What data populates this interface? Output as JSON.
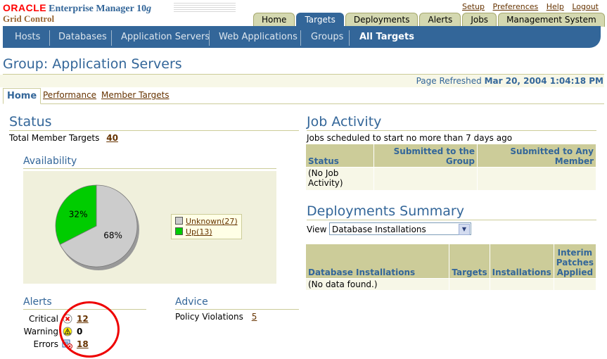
{
  "header": {
    "brand": "ORACLE",
    "product": "Enterprise Manager 10",
    "product_version_suffix": "g",
    "subproduct": "Grid Control",
    "global_links": [
      "Setup",
      "Preferences",
      "Help",
      "Logout"
    ]
  },
  "tabs": [
    {
      "label": "Home",
      "active": false
    },
    {
      "label": "Targets",
      "active": true
    },
    {
      "label": "Deployments",
      "active": false
    },
    {
      "label": "Alerts",
      "active": false
    },
    {
      "label": "Jobs",
      "active": false
    },
    {
      "label": "Management System",
      "active": false
    }
  ],
  "subnav": [
    {
      "label": "Hosts",
      "active": false
    },
    {
      "label": "Databases",
      "active": false
    },
    {
      "label": "Application Servers",
      "active": false
    },
    {
      "label": "Web Applications",
      "active": false
    },
    {
      "label": "Groups",
      "active": false
    },
    {
      "label": "All Targets",
      "active": true
    }
  ],
  "page": {
    "title": "Group: Application Servers",
    "refresh_label": "Page Refreshed",
    "refresh_time": "Mar 20, 2004 1:04:18 PM"
  },
  "subtabs": [
    "Home",
    "Performance",
    "Member Targets"
  ],
  "status": {
    "title": "Status",
    "total_label": "Total Member Targets",
    "total_value": "40",
    "availability_title": "Availability"
  },
  "chart_data": {
    "type": "pie",
    "slices": [
      {
        "label": "Unknown(27)",
        "value": 27,
        "percent_label": "68%",
        "color": "#cccccc"
      },
      {
        "label": "Up(13)",
        "value": 13,
        "percent_label": "32%",
        "color": "#00cc00"
      }
    ],
    "legend": "right"
  },
  "alerts": {
    "title": "Alerts",
    "rows": [
      {
        "label": "Critical",
        "icon": "critical-icon",
        "value": "12",
        "link": true
      },
      {
        "label": "Warning",
        "icon": "warning-icon",
        "value": "0",
        "link": false
      },
      {
        "label": "Errors",
        "icon": "errors-icon",
        "value": "18",
        "link": true
      }
    ]
  },
  "advice": {
    "title": "Advice",
    "label": "Policy Violations",
    "value": "5"
  },
  "job_activity": {
    "title": "Job Activity",
    "subtitle": "Jobs scheduled to start no more than 7 days ago",
    "columns": [
      "Status",
      "Submitted to the Group",
      "Submitted to Any Member"
    ],
    "rows": [
      [
        "(No Job Activity)",
        "",
        ""
      ]
    ]
  },
  "deployments": {
    "title": "Deployments Summary",
    "view_label": "View",
    "view_selected": "Database Installations",
    "columns": [
      "Database Installations",
      "Targets",
      "Installations",
      "Interim Patches Applied"
    ],
    "rows": [
      [
        "(No data found.)",
        "",
        "",
        ""
      ]
    ]
  },
  "colors": {
    "brand_red": "#ff0000",
    "nav_blue": "#336699",
    "tab_tan": "#d4d8b0",
    "annotation_red": "#ee0000"
  }
}
